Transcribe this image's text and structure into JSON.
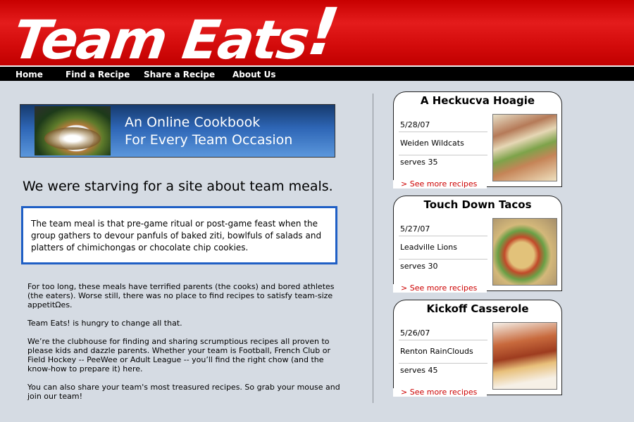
{
  "site": {
    "logo_text": "Team Eats",
    "logo_bang": "!"
  },
  "nav": {
    "items": [
      "Home",
      "Find a Recipe",
      "Share a Recipe",
      "About Us"
    ]
  },
  "banner": {
    "line1": "An Online Cookbook",
    "line2": "For Every Team Occasion"
  },
  "main": {
    "headline": "We were starving for a site about team meals.",
    "callout": "The team meal is that pre-game ritual or post-game feast when the group gathers to devour panfuls of baked ziti, bowlfuls of salads and platters of chimichongas or chocolate chip cookies.",
    "paragraphs": [
      "For too long, these meals have terrified parents (the cooks) and bored athletes (the eaters). Worse still, there was no place to find recipes to satisfy team-size appetitΩes.",
      "Team Eats! is hungry to change all that.",
      "We’re the clubhouse for finding and sharing scrumptious recipes all proven to please kids and dazzle parents. Whether your team is Football, French Club or Field Hockey -- PeeWee or Adult League -- you’ll find the right chow (and the know-how to prepare it) here.",
      "You can also share your team's most treasured recipes. So grab your mouse and join our team!"
    ]
  },
  "cards": [
    {
      "title": "A Heckucva Hoagie",
      "date": "5/28/07",
      "team": "Weiden Wildcats",
      "serves": "serves 35",
      "more": "> See more recipes"
    },
    {
      "title": "Touch Down Tacos",
      "date": "5/27/07",
      "team": "Leadville Lions",
      "serves": "serves 30",
      "more": "> See more recipes"
    },
    {
      "title": "Kickoff Casserole",
      "date": "5/26/07",
      "team": "Renton RainClouds",
      "serves": "serves 45",
      "more": "> See more recipes"
    }
  ],
  "colors": {
    "brand_red": "#d30b0b",
    "nav_bg": "#000000",
    "callout_border": "#1f5fc5",
    "link_red": "#cc0000",
    "page_bg": "#d5dbe3"
  }
}
